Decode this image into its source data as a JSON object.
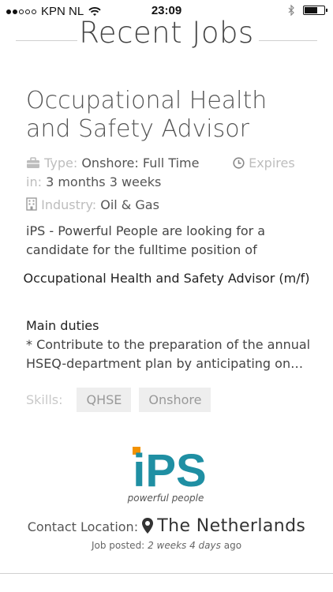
{
  "status_bar": {
    "carrier": "KPN NL",
    "time": "23:09",
    "signal_filled": 2,
    "signal_total": 5,
    "battery_level": 0.7
  },
  "page": {
    "title": "Recent Jobs"
  },
  "job": {
    "title": "Occupational Health and Safety Advisor",
    "type_label": "Type:",
    "type_value": "Onshore: Full Time",
    "expires_label": "Expires",
    "expires_in_label": "in:",
    "expires_value": "3 months 3 weeks",
    "industry_label": "Industry:",
    "industry_value": "Oil & Gas",
    "intro": "iPS - Powerful People are looking for a candidate for the fulltime position of",
    "position_heading": "Occupational Health and Safety Advisor (m/f)",
    "duties_heading": "Main duties",
    "duties_text": "* Contribute to the preparation of the annual HSEQ-department plan by anticipating on…",
    "skills_label": "Skills:",
    "skills": [
      "QHSE",
      "Onshore"
    ],
    "company_logo_text": "iPS",
    "company_tagline": "powerful people",
    "contact_label": "Contact Location:",
    "contact_value": "The Netherlands",
    "posted_label": "Job posted:",
    "posted_value": "2 weeks 4 days",
    "posted_suffix": "ago"
  },
  "colors": {
    "logo_orange": "#f39200",
    "logo_teal": "#1f8fa3"
  }
}
